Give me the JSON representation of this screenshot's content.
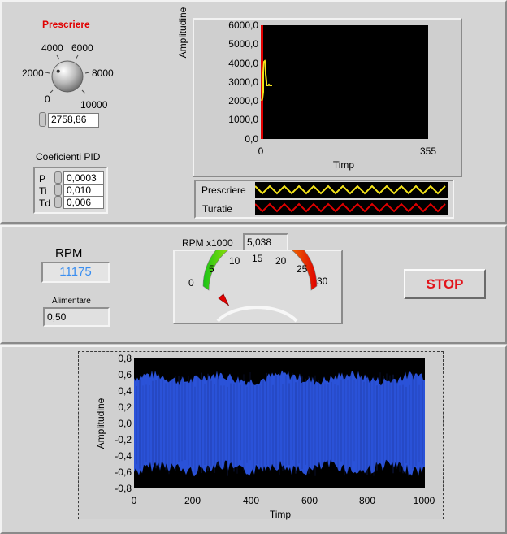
{
  "setpoint": {
    "label": "Prescriere",
    "knob_ticks": [
      "0",
      "2000",
      "4000",
      "6000",
      "8000",
      "10000"
    ],
    "value": "2758,86",
    "level_fraction": 0.276
  },
  "pid": {
    "label": "Coeficienti PID",
    "p_label": "P",
    "p_value": "0,0003",
    "ti_label": "Ti",
    "ti_value": "0,010",
    "td_label": "Td",
    "td_value": "0,006"
  },
  "top_chart": {
    "ylabel": "Amplitudine",
    "xlabel": "Timp",
    "y_ticks": [
      "6000,0",
      "5000,0",
      "4000,0",
      "3000,0",
      "2000,0",
      "1000,0",
      "0,0"
    ],
    "x_ticks": [
      "0",
      "355"
    ],
    "legend": {
      "setpoint_label": "Prescriere",
      "speed_label": "Turatie"
    }
  },
  "rpm": {
    "label": "RPM",
    "value": "11175",
    "supply_label": "Alimentare",
    "supply_value": "0,50"
  },
  "gauge": {
    "label": "RPM x1000",
    "value": "5,038",
    "ticks": [
      "0",
      "5",
      "10",
      "15",
      "20",
      "25",
      "30"
    ],
    "needle_value": 5.038
  },
  "stop_button": {
    "label": "STOP"
  },
  "bottom_chart": {
    "ylabel": "Amplitudine",
    "xlabel": "Timp",
    "y_ticks": [
      "0,8",
      "0,6",
      "0,4",
      "0,2",
      "0,0",
      "-0,2",
      "-0,4",
      "-0,6",
      "-0,8"
    ],
    "x_ticks": [
      "0",
      "200",
      "400",
      "600",
      "800",
      "1000"
    ]
  },
  "colors": {
    "setpoint_red": "#e00000",
    "trace_yellow": "#f4e41a",
    "waveform_blue": "#2a52d8",
    "rpm_text": "#3a8ef0",
    "stop_text": "#e2141b"
  }
}
